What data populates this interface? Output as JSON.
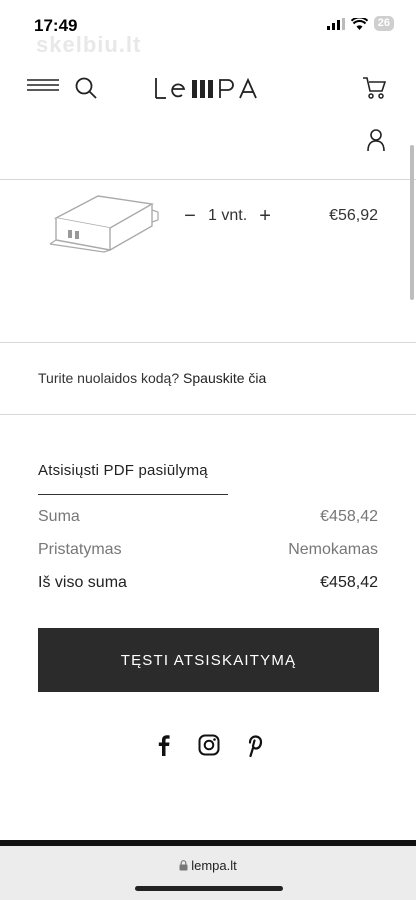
{
  "status": {
    "time": "17:49",
    "watermark": "skelbiu.lt",
    "battery": "26"
  },
  "header": {
    "logo_text": "LeIIIPa",
    "icons": [
      "menu-icon",
      "search-icon",
      "cart-icon",
      "user-icon"
    ]
  },
  "cart_item": {
    "quantity": "1 vnt.",
    "minus_label": "−",
    "plus_label": "+",
    "price": "€56,92"
  },
  "discount": {
    "prompt": "Turite nuolaidos kodą? ",
    "link": "Spauskite čia"
  },
  "pdf": {
    "label": "Atsisiųsti PDF pasiūlymą"
  },
  "summary": {
    "rows": [
      {
        "label": "Suma",
        "value": "€458,42"
      },
      {
        "label": "Pristatymas",
        "value": "Nemokamas"
      },
      {
        "label": "Iš viso suma",
        "value": "€458,42"
      }
    ]
  },
  "checkout": {
    "label": "TĘSTI ATSISKAITYMĄ"
  },
  "social": {
    "icons": [
      "facebook-icon",
      "instagram-icon",
      "pinterest-icon"
    ]
  },
  "browser": {
    "url": "lempa.lt"
  },
  "colors": {
    "button_bg": "#2b2b2b",
    "text": "#222222",
    "muted": "#777777",
    "divider": "#d8d8d8"
  }
}
